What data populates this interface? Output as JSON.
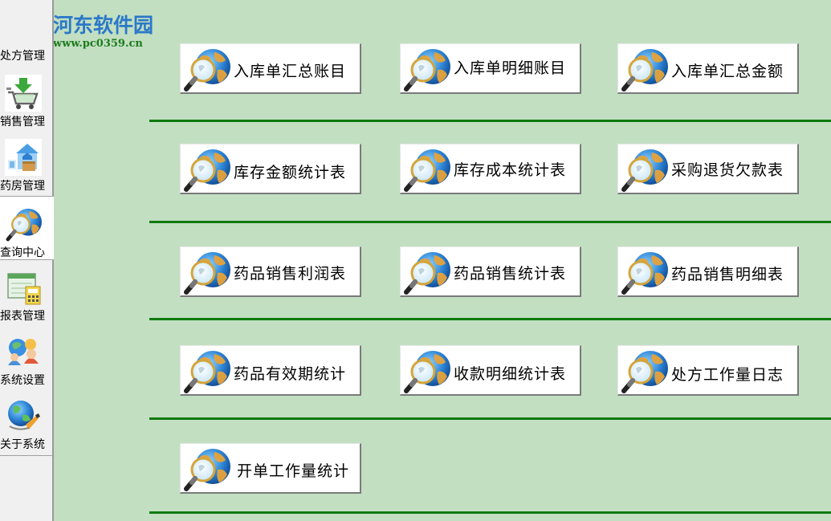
{
  "watermark": {
    "title": "河东软件园",
    "url": "www.pc0359.cn"
  },
  "sidebar": {
    "items": [
      {
        "label": "处方管理",
        "icon": "prescription-icon"
      },
      {
        "label": "销售管理",
        "icon": "shopping-cart-icon"
      },
      {
        "label": "药房管理",
        "icon": "pharmacy-box-icon"
      },
      {
        "label": "查询中心",
        "icon": "globe-magnifier-icon"
      },
      {
        "label": "报表管理",
        "icon": "report-calculator-icon"
      },
      {
        "label": "系统设置",
        "icon": "system-settings-icon"
      },
      {
        "label": "关于系统",
        "icon": "about-globe-icon"
      }
    ],
    "selected": "查询中心"
  },
  "reports": {
    "rows": [
      [
        "入库单汇总账目",
        "入库单明细账目",
        "入库单汇总金额"
      ],
      [
        "库存金额统计表",
        "库存成本统计表",
        "采购退货欠款表"
      ],
      [
        "药品销售利润表",
        "药品销售统计表",
        "药品销售明细表"
      ],
      [
        "药品有效期统计",
        "收款明细统计表",
        "处方工作量日志"
      ],
      [
        "开单工作量统计"
      ]
    ],
    "button_icon": "globe-magnifier-icon"
  },
  "colors": {
    "background": "#c2dfc2",
    "divider": "#0e7a0e",
    "watermark_title": "#2b78c8",
    "watermark_url": "#1c7a1c"
  }
}
